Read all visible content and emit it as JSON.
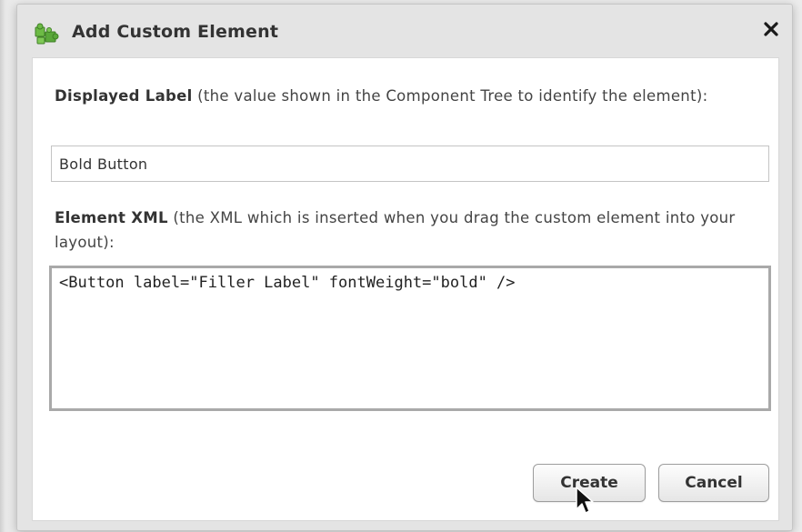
{
  "dialog": {
    "title": "Add Custom Element",
    "title_icon": "puzzle-pieces-icon",
    "close_icon": "close-x-icon"
  },
  "label_field": {
    "heading": "Displayed Label",
    "description": " (the value shown in the Component Tree to identify the element):",
    "value": "Bold Button"
  },
  "xml_field": {
    "heading": "Element XML",
    "description": " (the XML which is inserted when you drag the custom element into your layout):",
    "value": "<Button label=\"Filler Label\" fontWeight=\"bold\" />"
  },
  "buttons": {
    "create_label": "Create",
    "cancel_label": "Cancel"
  },
  "colors": {
    "icon_green": "#5aa83a",
    "panel_bg": "#ffffff",
    "frame_bg": "#e4e4e4"
  }
}
